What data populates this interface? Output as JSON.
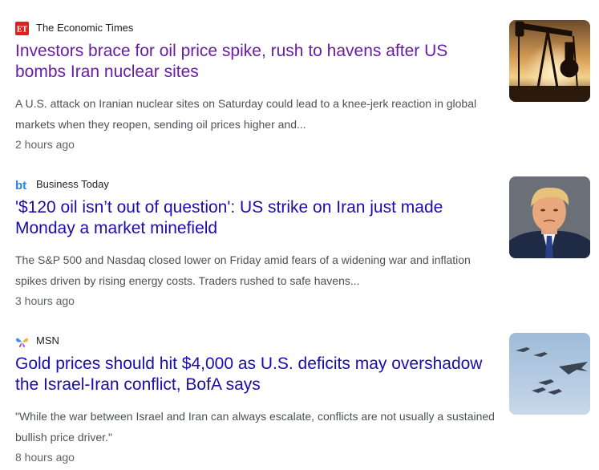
{
  "articles": [
    {
      "source": {
        "name": "The Economic Times",
        "logo": "ET",
        "logo_color": "#e0201b"
      },
      "headline": "Investors brace for oil price spike, rush to havens after US bombs Iran nuclear sites",
      "headline_color": "#681da8",
      "snippet": "A U.S. attack on Iranian nuclear sites on Saturday could lead to a knee-jerk reaction in global markets when they reopen, sending oil prices higher and...",
      "time": "2 hours ago",
      "thumbnail": "oil-pumpjack-sunset-image"
    },
    {
      "source": {
        "name": "Business Today",
        "logo": "bt",
        "logo_color": "#1e88e5"
      },
      "headline": "'$120 oil isn’t out of question': US strike on Iran just made Monday a market minefield",
      "headline_color": "#1a0dab",
      "snippet": "The S&P 500 and Nasdaq closed lower on Friday amid fears of a widening war and inflation spikes driven by rising energy costs. Traders rushed to safe havens...",
      "time": "3 hours ago",
      "thumbnail": "portrait-photo-image"
    },
    {
      "source": {
        "name": "MSN",
        "logo": "msn-butterfly",
        "logo_color": "#3d8ef7"
      },
      "headline": "Gold prices should hit $4,000 as U.S. deficits may overshadow the Israel-Iran conflict, BofA says",
      "headline_color": "#1a0dab",
      "snippet": "\"While the war between Israel and Iran can always escalate, conflicts are not usually a sustained bullish price driver.\"",
      "time": "8 hours ago",
      "thumbnail": "military-aircraft-formation-image"
    }
  ]
}
